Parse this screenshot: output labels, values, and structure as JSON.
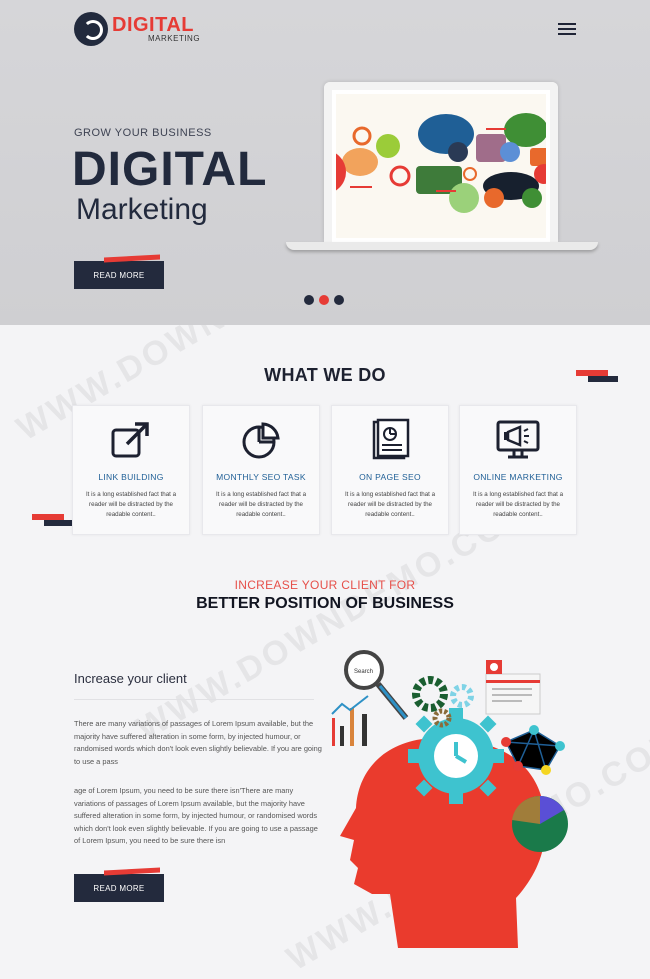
{
  "brand": {
    "title": "DIGITAL",
    "subtitle": "MARKETING"
  },
  "hero": {
    "kicker": "GROW YOUR BUSINESS",
    "title": "DIGITAL",
    "subtitle": "Marketing",
    "button_label": "READ MORE",
    "slides": 3,
    "active_slide": 2
  },
  "what_we_do": {
    "title": "WHAT WE DO",
    "cards": [
      {
        "title": "LINK BUILDING",
        "text": "It is a long established fact that a reader will be distracted by the readable content..",
        "icon": "external-link-icon"
      },
      {
        "title": "MONTHLY SEO TASK",
        "text": "It is a long established fact that a reader will be distracted by the readable content..",
        "icon": "pie-chart-icon"
      },
      {
        "title": "ON PAGE SEO",
        "text": "It is a long established fact that a reader will be distracted by the readable content..",
        "icon": "report-icon"
      },
      {
        "title": "ONLINE MARKETING",
        "text": "It is a long established fact that a reader will be distracted by the readable content..",
        "icon": "megaphone-monitor-icon"
      }
    ]
  },
  "increase": {
    "kicker": "INCREASE YOUR CLIENT FOR",
    "title": "BETTER POSITION OF BUSINESS",
    "heading": "Increase your client",
    "para1": "There are many variations of passages of Lorem Ipsum available, but the majority have suffered alteration in some form, by injected humour, or randomised words which don't look even slightly believable. If you are going to use a pass",
    "para2": "age of Lorem Ipsum, you need to be sure there isn'There are many variations of passages of Lorem Ipsum available, but the majority have suffered alteration in some form, by injected humour, or randomised words which don't look even slightly believable. If you are going to use a passage of Lorem Ipsum, you need to be sure there isn",
    "button_label": "READ MORE",
    "search_label": "Search"
  },
  "watermark": "WWW.DOWNDEMO.COM",
  "colors": {
    "accent": "#e63b35",
    "navy": "#232a3d",
    "link_blue": "#1f5f96"
  }
}
